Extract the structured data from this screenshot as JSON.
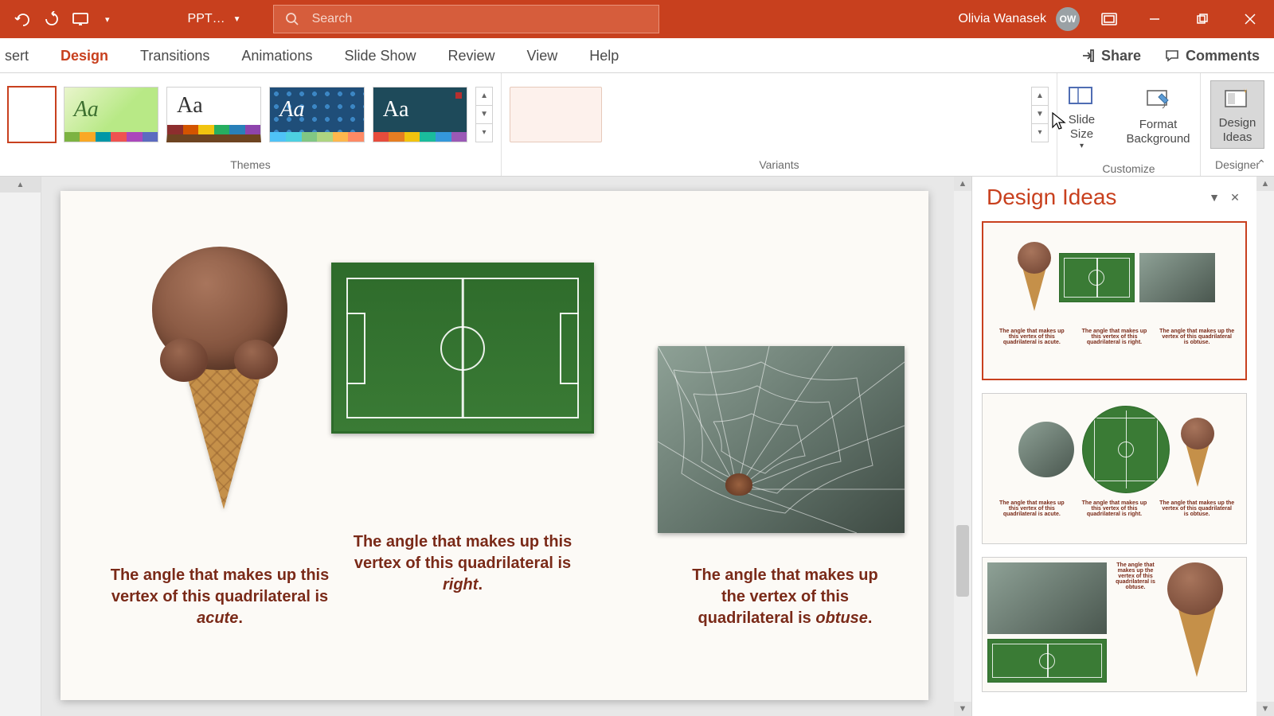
{
  "titlebar": {
    "doc_name": "PPT…",
    "search_placeholder": "Search",
    "user_name": "Olivia Wanasek",
    "user_initials": "OW"
  },
  "tabs": {
    "insert": "sert",
    "design": "Design",
    "transitions": "Transitions",
    "animations": "Animations",
    "slideshow": "Slide Show",
    "review": "Review",
    "view": "View",
    "help": "Help",
    "share": "Share",
    "comments": "Comments"
  },
  "ribbon": {
    "themes_label": "Themes",
    "variants_label": "Variants",
    "customize_label": "Customize",
    "designer_label": "Designer",
    "slide_size": "Slide\nSize",
    "format_bg": "Format\nBackground",
    "design_ideas": "Design\nIdeas",
    "theme_sample": "Aa"
  },
  "slide": {
    "caption1_pre": "The angle that makes up this vertex of this quadrilateral  is ",
    "caption1_em": "acute",
    "caption2_pre": "The angle that makes up this vertex of this quadrilateral  is ",
    "caption2_em": "right",
    "caption3_pre": "The angle that makes up the vertex of this quadrilateral  is ",
    "caption3_em": "obtuse",
    "period": "."
  },
  "pane": {
    "title": "Design Ideas",
    "mini_cap1": "The angle that makes up this vertex of this quadrilateral  is acute.",
    "mini_cap2": "The angle that makes up this vertex of this quadrilateral  is right.",
    "mini_cap3": "The angle that makes up the vertex of this quadrilateral  is obtuse."
  }
}
